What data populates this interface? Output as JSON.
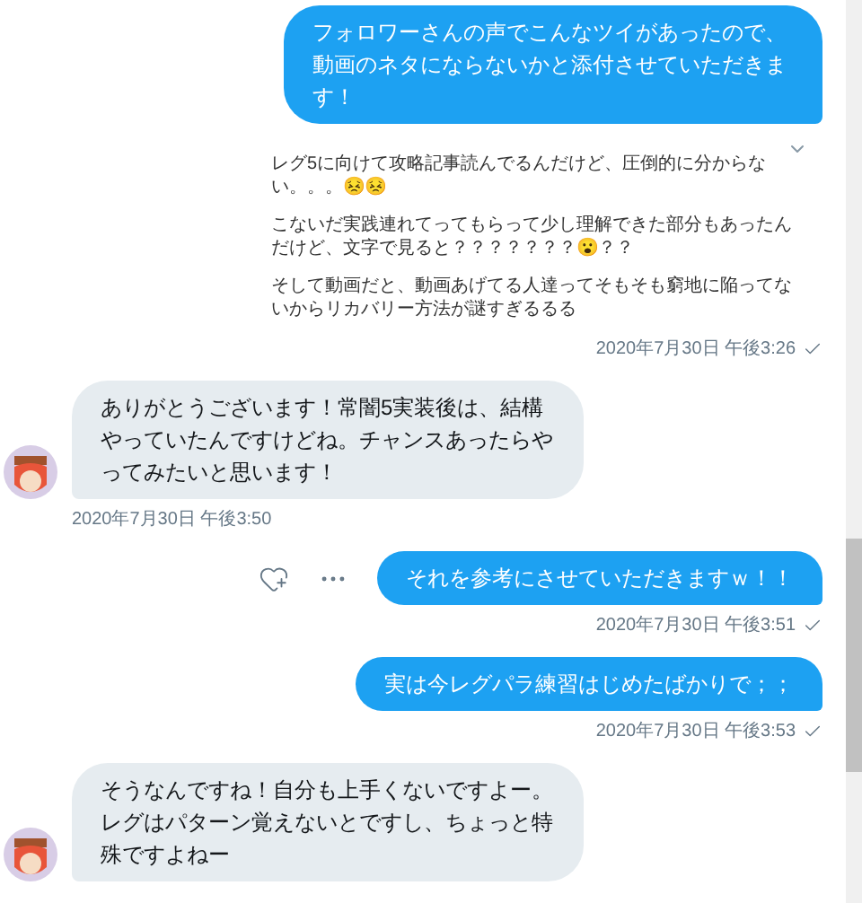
{
  "messages": [
    {
      "kind": "sent",
      "text": "フォロワーさんの声でこんなツイがあったので、動画のネタにならないかと添付させていただきます！",
      "quote": [
        "レグ5に向けて攻略記事読んでるんだけど、圧倒的に分からない。。。😣😣",
        "こないだ実践連れてってもらって少し理解できた部分もあったんだけど、文字で見ると？？？？？？？😮？？",
        "そして動画だと、動画あげてる人達ってそもそも窮地に陥ってないからリカバリー方法が謎すぎるるる"
      ],
      "time": "2020年7月30日 午後3:26",
      "read": true,
      "show_actions": false
    },
    {
      "kind": "received",
      "text": "ありがとうございます！常闇5実装後は、結構やっていたんですけどね。チャンスあったらやってみたいと思います！",
      "time": "2020年7月30日 午後3:50"
    },
    {
      "kind": "sent",
      "text": "それを参考にさせていただきますｗ！！",
      "time": "2020年7月30日 午後3:51",
      "read": true,
      "show_actions": true
    },
    {
      "kind": "sent",
      "text": "実は今レグパラ練習はじめたばかりで；；",
      "time": "2020年7月30日 午後3:53",
      "read": true,
      "show_actions": false
    },
    {
      "kind": "received",
      "text": "そうなんですね！自分も上手くないですよー。レグはパターン覚えないとですし、ちょっと特殊ですよねー"
    }
  ]
}
